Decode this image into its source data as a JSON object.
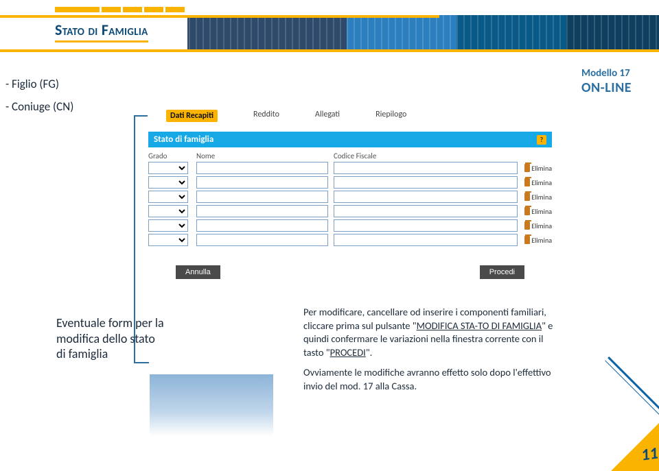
{
  "title": "Stato di Famiglia",
  "left_items": [
    "- Figlio   (FG)",
    "- Coniuge   (CN)"
  ],
  "modello": {
    "line1": "Modello 17",
    "line2": "ON-LINE"
  },
  "tabs": [
    "Dati Recapiti",
    "Reddito",
    "Allegati",
    "Riepilogo"
  ],
  "panel": {
    "title": "Stato di famiglia",
    "help": "?",
    "columns": [
      "Grado",
      "Nome",
      "Codice Fiscale",
      ""
    ],
    "delete_label": "Elimina",
    "row_count": 6,
    "annulla": "Annulla",
    "procedi": "Procedi"
  },
  "form_label_lines": [
    "Eventuale form per la",
    "modifica dello stato",
    "di famiglia"
  ],
  "desc": {
    "p1a": "Per modificare, cancellare od inserire i componenti familiari, cliccare prima sul pulsante \"",
    "p1u1": "MODIFICA STA-",
    "p1b": "",
    "p1u2": "TO DI FAMIGLIA",
    "p1c": "\" e quindi confermare le variazioni nella finestra corrente con il tasto \"",
    "p1u3": "PROCEDI",
    "p1d": "\".",
    "p2": "Ovviamente le modifiche avranno effetto solo dopo l'effettivo invio del mod. 17 alla Cassa."
  },
  "page_number": "11"
}
